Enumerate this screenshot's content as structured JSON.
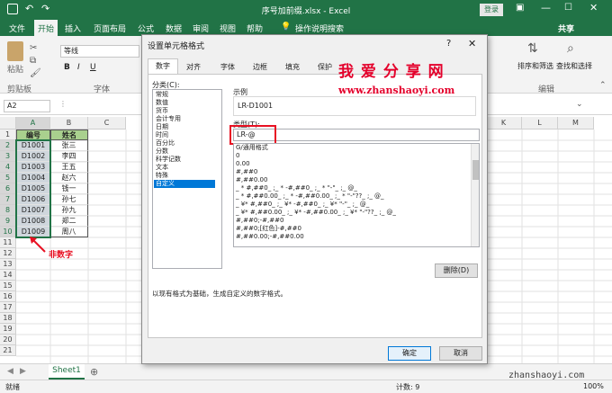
{
  "window": {
    "title": "序号加前缀.xlsx  -  Excel",
    "login": "登录"
  },
  "ribbon_tabs": [
    "文件",
    "开始",
    "插入",
    "页面布局",
    "公式",
    "数据",
    "审阅",
    "视图",
    "帮助"
  ],
  "tell_me": "操作说明搜索",
  "share": "共享",
  "ribbon": {
    "paste": "粘贴",
    "clipboard": "剪贴板",
    "font_name": "等线",
    "bold": "B",
    "italic": "I",
    "underline": "U",
    "font_group": "字体",
    "sort": "排序和筛选",
    "find": "查找和选择",
    "edit": "编辑"
  },
  "namebox": "A2",
  "columns": [
    "A",
    "B",
    "C"
  ],
  "right_columns": [
    "K",
    "L",
    "M"
  ],
  "rows": [
    "1",
    "2",
    "3",
    "4",
    "5",
    "6",
    "7",
    "8",
    "9",
    "10",
    "11",
    "12",
    "13",
    "14",
    "15",
    "16",
    "17",
    "18",
    "19",
    "20",
    "21"
  ],
  "table": {
    "headers": [
      "编号",
      "姓名"
    ],
    "rows": [
      [
        "D1001",
        "张三"
      ],
      [
        "D1002",
        "李四"
      ],
      [
        "D1003",
        "王五"
      ],
      [
        "D1004",
        "赵六"
      ],
      [
        "D1005",
        "钱一"
      ],
      [
        "D1006",
        "孙七"
      ],
      [
        "D1007",
        "孙九"
      ],
      [
        "D1008",
        "郑二"
      ],
      [
        "D1009",
        "周八"
      ]
    ]
  },
  "annotation": "非数字",
  "sheet_tab": "Sheet1",
  "status": {
    "ready": "就绪",
    "count": "计数: 9",
    "zoom": "100%"
  },
  "dialog": {
    "title": "设置单元格格式",
    "help": "?",
    "tabs": [
      "数字",
      "对齐",
      "字体",
      "边框",
      "填充",
      "保护"
    ],
    "category_label": "分类(C):",
    "categories": [
      "常规",
      "数值",
      "货币",
      "会计专用",
      "日期",
      "时间",
      "百分比",
      "分数",
      "科学记数",
      "文本",
      "特殊",
      "自定义"
    ],
    "selected_category": "自定义",
    "sample_label": "示例",
    "sample_value": "LR-D1001",
    "type_label": "类型(T):",
    "type_value": "LR-@",
    "formats": [
      "G/通用格式",
      "0",
      "0.00",
      "#,##0",
      "#,##0.00",
      "_ * #,##0_ ;_ * -#,##0_ ;_ * \"-\"_ ;_ @_",
      "_ * #,##0.00_ ;_ * -#,##0.00_ ;_ * \"-\"??_ ;_ @_",
      "_ ¥* #,##0_ ;_ ¥* -#,##0_ ;_ ¥* \"-\"_ ;_ @_",
      "_ ¥* #,##0.00_ ;_ ¥* -#,##0.00_ ;_ ¥* \"-\"??_ ;_ @_",
      "#,##0;-#,##0",
      "#,##0;[红色]-#,##0",
      "#,##0.00;-#,##0.00"
    ],
    "delete": "删除(D)",
    "description": "以现有格式为基础，生成自定义的数字格式。",
    "ok": "确定",
    "cancel": "取消"
  },
  "watermark": {
    "title": "我 爱 分 享 网",
    "url": "www.zhanshaoyi.com",
    "corner": "zhanshaoyi.com"
  },
  "colors": {
    "excel_green": "#217346",
    "accent_red": "#e81123",
    "watermark_red": "#e4002b",
    "selection": "#0078d7"
  }
}
